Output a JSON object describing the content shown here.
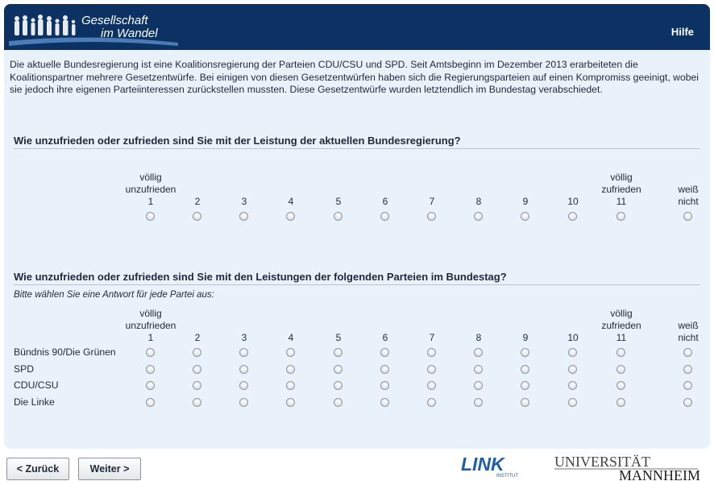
{
  "header": {
    "logo_line1": "Gesellschaft",
    "logo_line2": "im Wandel",
    "help_label": "Hilfe"
  },
  "intro": "Die aktuelle Bundesregierung ist eine Koalitionsregierung der Parteien CDU/CSU und SPD. Seit Amtsbeginn im Dezember 2013 erarbeiteten die Koalitionspartner mehrere Gesetzentwürfe. Bei einigen von diesen Gesetzentwürfen haben sich die Regierungsparteien auf einen Kompromiss geeinigt, wobei sie jedoch ihre eigenen Parteiinteressen zurückstellen mussten. Diese Gesetzentwürfe wurden letztendlich im Bundestag verabschiedet.",
  "q1": {
    "title": "Wie unzufrieden oder zufrieden sind Sie mit der Leistung der aktuellen Bundesregierung?"
  },
  "q2": {
    "title": "Wie unzufrieden oder zufrieden sind Sie mit den Leistungen der folgenden Parteien im Bundestag?",
    "instruction": "Bitte wählen Sie eine Antwort für jede Partei aus:",
    "rows": [
      "Bündnis 90/Die Grünen",
      "SPD",
      "CDU/CSU",
      "Die Linke"
    ]
  },
  "scale": {
    "low_anchor_line1": "völlig",
    "low_anchor_line2": "unzufrieden",
    "high_anchor_line1": "völlig",
    "high_anchor_line2": "zufrieden",
    "dk_line1": "weiß",
    "dk_line2": "nicht",
    "points": [
      "1",
      "2",
      "3",
      "4",
      "5",
      "6",
      "7",
      "8",
      "9",
      "10",
      "11"
    ]
  },
  "nav": {
    "back_label": "< Zurück",
    "next_label": "Weiter >"
  },
  "logos": {
    "link_text": "LINK",
    "link_sub": "INSTITUT",
    "uni_line1": "UNIVERSITÄT",
    "uni_line2": "MANNHEIM"
  },
  "colors": {
    "header_bg": "#0c3263",
    "panel_bg": "#e9f1fa",
    "link_blue": "#1f5fa8"
  }
}
